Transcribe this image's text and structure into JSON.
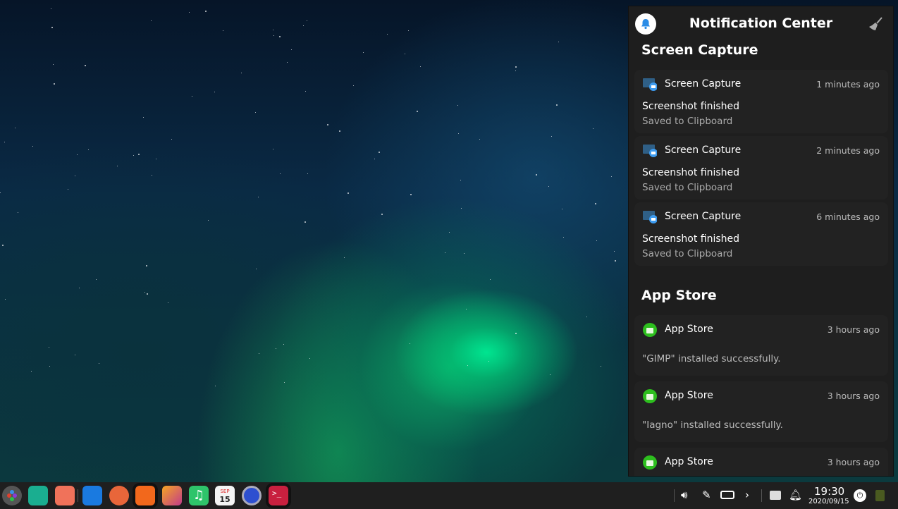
{
  "notification_center": {
    "title": "Notification Center",
    "groups": [
      {
        "name": "Screen Capture",
        "items": [
          {
            "app": "Screen Capture",
            "time": "1 minutes ago",
            "summary": "Screenshot finished",
            "body": "Saved to Clipboard"
          },
          {
            "app": "Screen Capture",
            "time": "2 minutes ago",
            "summary": "Screenshot finished",
            "body": "Saved to Clipboard"
          },
          {
            "app": "Screen Capture",
            "time": "6 minutes ago",
            "summary": "Screenshot finished",
            "body": "Saved to Clipboard"
          }
        ]
      },
      {
        "name": "App Store",
        "items": [
          {
            "app": "App Store",
            "time": "3 hours ago",
            "body": "\"GIMP\" installed successfully."
          },
          {
            "app": "App Store",
            "time": "3 hours ago",
            "body": "\"Iagno\" installed successfully."
          },
          {
            "app": "App Store",
            "time": "3 hours ago"
          }
        ]
      }
    ]
  },
  "taskbar": {
    "apps": [
      "launcher",
      "file-manager",
      "multitasking-view",
      "app-store-helper",
      "firefox",
      "app-store",
      "image-viewer",
      "music",
      "calendar",
      "control-center",
      "terminal"
    ],
    "calendar_icon": {
      "month": "SEP",
      "day": "15"
    },
    "clock": {
      "time": "19:30",
      "date": "2020/09/15"
    }
  },
  "colors": {
    "panel": "#1e1e1e",
    "accent": "#2b8ce6",
    "appstore": "#2dbe1e"
  }
}
